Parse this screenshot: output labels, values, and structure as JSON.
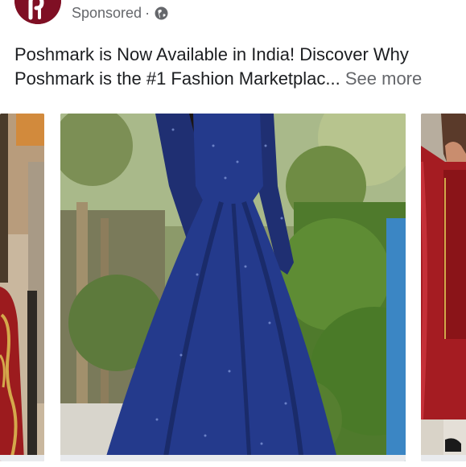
{
  "post": {
    "advertiser_logo": "poshmark-logo-icon",
    "sponsored_label": "Sponsored",
    "separator": "·",
    "privacy_icon": "globe-icon",
    "caption_line1": "Poshmark is Now Available in India! Discover Why",
    "caption_line2": "Poshmark is the #1 Fashion Marketplac...",
    "see_more": "See more"
  },
  "carousel": {
    "cards": [
      {
        "name": "card-left",
        "image": "red embroidered dress partial"
      },
      {
        "name": "card-main",
        "image": "navy blue sequin gown"
      },
      {
        "name": "card-right",
        "image": "red embroidered suit partial"
      }
    ]
  },
  "colors": {
    "brand": "#7f0f24",
    "secondary_text": "#65676b",
    "primary_text": "#1c1e21",
    "gown": "#243a8c"
  }
}
